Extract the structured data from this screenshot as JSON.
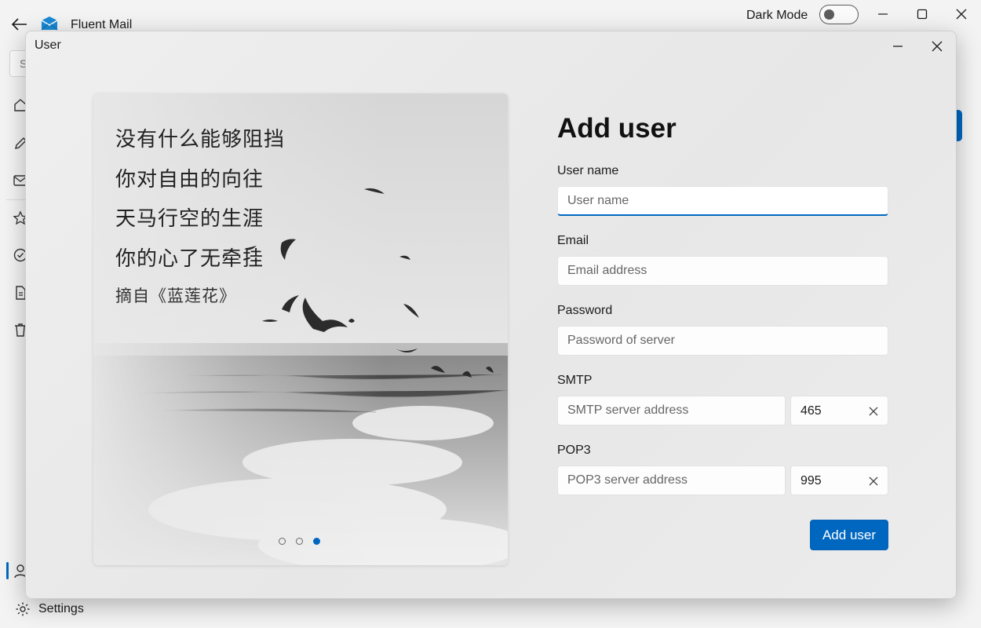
{
  "app": {
    "title": "Fluent Mail",
    "dark_mode_label": "Dark Mode",
    "dark_mode_on": false,
    "search_stub": "S",
    "settings_label": "Settings",
    "accent": "#0067c0"
  },
  "sidebar": {
    "icons": [
      "home-icon",
      "edit-icon",
      "mail-icon",
      "star-icon",
      "check-circle-icon",
      "document-icon",
      "trash-icon",
      "person-icon",
      "gear-icon"
    ],
    "active": "person-icon"
  },
  "dialog": {
    "title": "User",
    "poem": {
      "lines": [
        "没有什么能够阻挡",
        "你对自由的向往",
        "天马行空的生涯",
        "你的心了无牵挂"
      ],
      "source": "摘自《蓝莲花》"
    },
    "pager": {
      "count": 3,
      "active_index": 2
    },
    "form": {
      "heading": "Add user",
      "username": {
        "label": "User name",
        "placeholder": "User name",
        "value": ""
      },
      "email": {
        "label": "Email",
        "placeholder": "Email address",
        "value": ""
      },
      "password": {
        "label": "Password",
        "placeholder": "Password of server",
        "value": ""
      },
      "smtp": {
        "label": "SMTP",
        "placeholder": "SMTP server address",
        "port": "465"
      },
      "pop3": {
        "label": "POP3",
        "placeholder": "POP3 server address",
        "port": "995"
      },
      "submit_label": "Add user"
    }
  }
}
